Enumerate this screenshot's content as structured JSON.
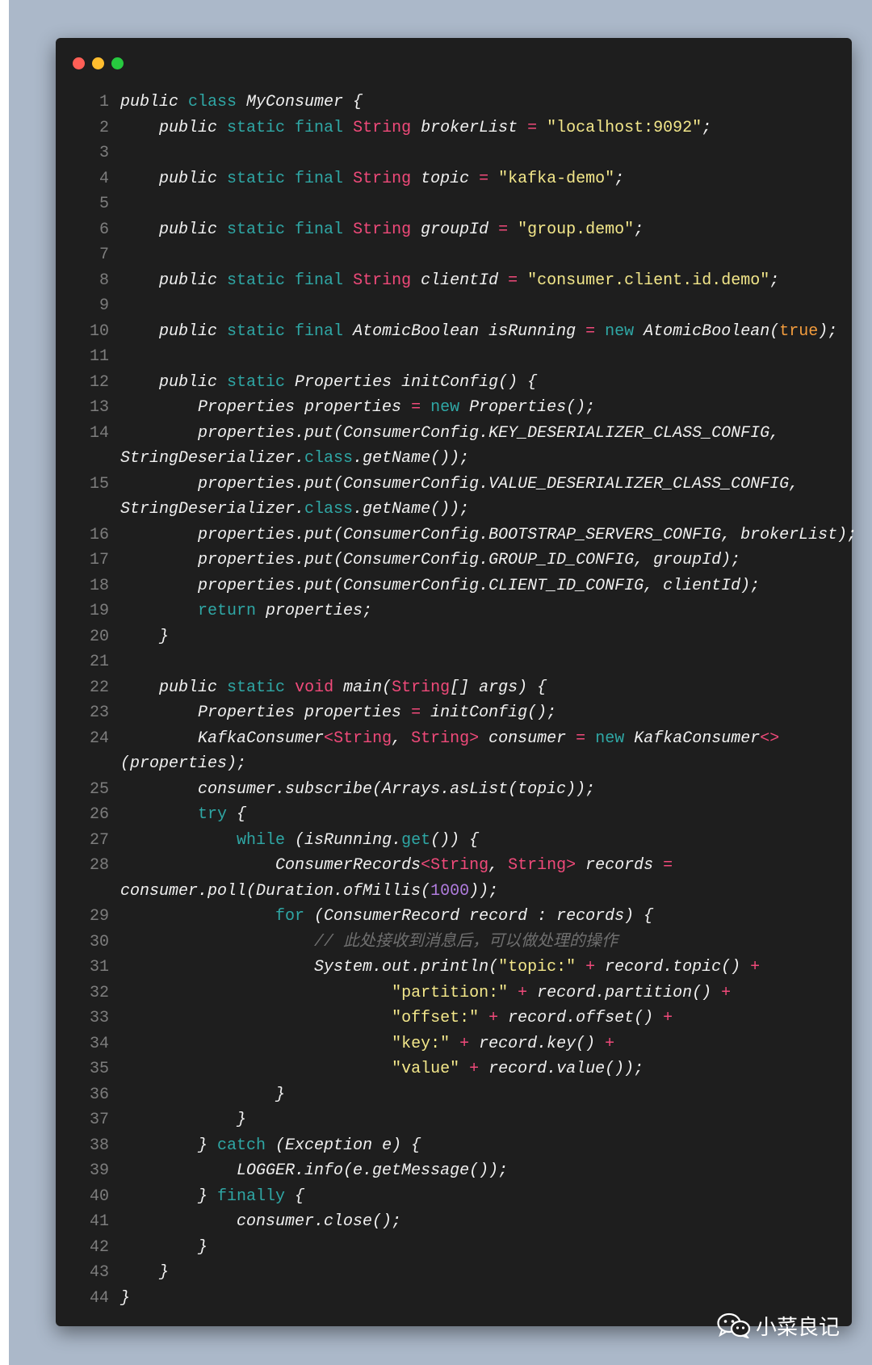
{
  "window": {
    "controls": [
      {
        "name": "close",
        "color": "#ff5f56"
      },
      {
        "name": "minimize",
        "color": "#ffbd2e"
      },
      {
        "name": "zoom",
        "color": "#27c93f"
      }
    ]
  },
  "code_lines": [
    {
      "n": "1",
      "t": [
        [
          "plain",
          "public "
        ],
        [
          "kw",
          "class"
        ],
        [
          "plain",
          " MyConsumer {"
        ]
      ]
    },
    {
      "n": "2",
      "t": [
        [
          "plain",
          "    public "
        ],
        [
          "kw",
          "static final"
        ],
        [
          "plain",
          " "
        ],
        [
          "ty",
          "String"
        ],
        [
          "plain",
          " brokerList "
        ],
        [
          "op",
          "="
        ],
        [
          "plain",
          " "
        ],
        [
          "str",
          "\"localhost:9092\""
        ],
        [
          "plain",
          ";"
        ]
      ]
    },
    {
      "n": "3",
      "t": []
    },
    {
      "n": "4",
      "t": [
        [
          "plain",
          "    public "
        ],
        [
          "kw",
          "static final"
        ],
        [
          "plain",
          " "
        ],
        [
          "ty",
          "String"
        ],
        [
          "plain",
          " topic "
        ],
        [
          "op",
          "="
        ],
        [
          "plain",
          " "
        ],
        [
          "str",
          "\"kafka-demo\""
        ],
        [
          "plain",
          ";"
        ]
      ]
    },
    {
      "n": "5",
      "t": []
    },
    {
      "n": "6",
      "t": [
        [
          "plain",
          "    public "
        ],
        [
          "kw",
          "static final"
        ],
        [
          "plain",
          " "
        ],
        [
          "ty",
          "String"
        ],
        [
          "plain",
          " groupId "
        ],
        [
          "op",
          "="
        ],
        [
          "plain",
          " "
        ],
        [
          "str",
          "\"group.demo\""
        ],
        [
          "plain",
          ";"
        ]
      ]
    },
    {
      "n": "7",
      "t": []
    },
    {
      "n": "8",
      "t": [
        [
          "plain",
          "    public "
        ],
        [
          "kw",
          "static final"
        ],
        [
          "plain",
          " "
        ],
        [
          "ty",
          "String"
        ],
        [
          "plain",
          " clientId "
        ],
        [
          "op",
          "="
        ],
        [
          "plain",
          " "
        ],
        [
          "str",
          "\"consumer.client.id.demo\""
        ],
        [
          "plain",
          ";"
        ]
      ]
    },
    {
      "n": "9",
      "t": []
    },
    {
      "n": "10",
      "t": [
        [
          "plain",
          "    public "
        ],
        [
          "kw",
          "static final"
        ],
        [
          "plain",
          " AtomicBoolean isRunning "
        ],
        [
          "op",
          "="
        ],
        [
          "plain",
          " "
        ],
        [
          "kw",
          "new"
        ],
        [
          "plain",
          " AtomicBoolean("
        ],
        [
          "bool",
          "true"
        ],
        [
          "plain",
          ");"
        ]
      ]
    },
    {
      "n": "11",
      "t": []
    },
    {
      "n": "12",
      "t": [
        [
          "plain",
          "    public "
        ],
        [
          "kw",
          "static"
        ],
        [
          "plain",
          " Properties initConfig() {"
        ]
      ]
    },
    {
      "n": "13",
      "t": [
        [
          "plain",
          "        Properties properties "
        ],
        [
          "op",
          "="
        ],
        [
          "plain",
          " "
        ],
        [
          "kw",
          "new"
        ],
        [
          "plain",
          " Properties();"
        ]
      ]
    },
    {
      "n": "14",
      "t": [
        [
          "plain",
          "        properties.put(ConsumerConfig.KEY_DESERIALIZER_CLASS_CONFIG,"
        ]
      ]
    },
    {
      "n": "",
      "t": [
        [
          "plain",
          "StringDeserializer."
        ],
        [
          "kw",
          "class"
        ],
        [
          "plain",
          ".getName());"
        ]
      ]
    },
    {
      "n": "15",
      "t": [
        [
          "plain",
          "        properties.put(ConsumerConfig.VALUE_DESERIALIZER_CLASS_CONFIG,"
        ]
      ]
    },
    {
      "n": "",
      "t": [
        [
          "plain",
          "StringDeserializer."
        ],
        [
          "kw",
          "class"
        ],
        [
          "plain",
          ".getName());"
        ]
      ]
    },
    {
      "n": "16",
      "t": [
        [
          "plain",
          "        properties.put(ConsumerConfig.BOOTSTRAP_SERVERS_CONFIG, brokerList);"
        ]
      ]
    },
    {
      "n": "17",
      "t": [
        [
          "plain",
          "        properties.put(ConsumerConfig.GROUP_ID_CONFIG, groupId);"
        ]
      ]
    },
    {
      "n": "18",
      "t": [
        [
          "plain",
          "        properties.put(ConsumerConfig.CLIENT_ID_CONFIG, clientId);"
        ]
      ]
    },
    {
      "n": "19",
      "t": [
        [
          "plain",
          "        "
        ],
        [
          "kw",
          "return"
        ],
        [
          "plain",
          " properties;"
        ]
      ]
    },
    {
      "n": "20",
      "t": [
        [
          "plain",
          "    }"
        ]
      ]
    },
    {
      "n": "21",
      "t": []
    },
    {
      "n": "22",
      "t": [
        [
          "plain",
          "    public "
        ],
        [
          "kw",
          "static"
        ],
        [
          "plain",
          " "
        ],
        [
          "ty",
          "void"
        ],
        [
          "plain",
          " main("
        ],
        [
          "ty",
          "String"
        ],
        [
          "plain",
          "[] args) {"
        ]
      ]
    },
    {
      "n": "23",
      "t": [
        [
          "plain",
          "        Properties properties "
        ],
        [
          "op",
          "="
        ],
        [
          "plain",
          " initConfig();"
        ]
      ]
    },
    {
      "n": "24",
      "t": [
        [
          "plain",
          "        KafkaConsumer"
        ],
        [
          "op",
          "<"
        ],
        [
          "ty",
          "String"
        ],
        [
          "plain",
          ", "
        ],
        [
          "ty",
          "String"
        ],
        [
          "op",
          ">"
        ],
        [
          "plain",
          " consumer "
        ],
        [
          "op",
          "="
        ],
        [
          "plain",
          " "
        ],
        [
          "kw",
          "new"
        ],
        [
          "plain",
          " KafkaConsumer"
        ],
        [
          "op",
          "<>"
        ]
      ]
    },
    {
      "n": "",
      "t": [
        [
          "plain",
          "(properties);"
        ]
      ]
    },
    {
      "n": "25",
      "t": [
        [
          "plain",
          "        consumer.subscribe(Arrays.asList(topic));"
        ]
      ]
    },
    {
      "n": "26",
      "t": [
        [
          "plain",
          "        "
        ],
        [
          "kw",
          "try"
        ],
        [
          "plain",
          " {"
        ]
      ]
    },
    {
      "n": "27",
      "t": [
        [
          "plain",
          "            "
        ],
        [
          "kw",
          "while"
        ],
        [
          "plain",
          " (isRunning."
        ],
        [
          "kw",
          "get"
        ],
        [
          "plain",
          "()) {"
        ]
      ]
    },
    {
      "n": "28",
      "t": [
        [
          "plain",
          "                ConsumerRecords"
        ],
        [
          "op",
          "<"
        ],
        [
          "ty",
          "String"
        ],
        [
          "plain",
          ", "
        ],
        [
          "ty",
          "String"
        ],
        [
          "op",
          ">"
        ],
        [
          "plain",
          " records "
        ],
        [
          "op",
          "="
        ]
      ]
    },
    {
      "n": "",
      "t": [
        [
          "plain",
          "consumer.poll(Duration.ofMillis("
        ],
        [
          "num",
          "1000"
        ],
        [
          "plain",
          "));"
        ]
      ]
    },
    {
      "n": "29",
      "t": [
        [
          "plain",
          "                "
        ],
        [
          "kw",
          "for"
        ],
        [
          "plain",
          " (ConsumerRecord record : records) {"
        ]
      ]
    },
    {
      "n": "30",
      "t": [
        [
          "plain",
          "                    "
        ],
        [
          "cm",
          "// 此处接收到消息后，可以做处理的操作"
        ]
      ]
    },
    {
      "n": "31",
      "t": [
        [
          "plain",
          "                    System.out.println("
        ],
        [
          "str",
          "\"topic:\""
        ],
        [
          "plain",
          " "
        ],
        [
          "op",
          "+"
        ],
        [
          "plain",
          " record.topic() "
        ],
        [
          "op",
          "+"
        ]
      ]
    },
    {
      "n": "32",
      "t": [
        [
          "plain",
          "                            "
        ],
        [
          "str",
          "\"partition:\""
        ],
        [
          "plain",
          " "
        ],
        [
          "op",
          "+"
        ],
        [
          "plain",
          " record.partition() "
        ],
        [
          "op",
          "+"
        ]
      ]
    },
    {
      "n": "33",
      "t": [
        [
          "plain",
          "                            "
        ],
        [
          "str",
          "\"offset:\""
        ],
        [
          "plain",
          " "
        ],
        [
          "op",
          "+"
        ],
        [
          "plain",
          " record.offset() "
        ],
        [
          "op",
          "+"
        ]
      ]
    },
    {
      "n": "34",
      "t": [
        [
          "plain",
          "                            "
        ],
        [
          "str",
          "\"key:\""
        ],
        [
          "plain",
          " "
        ],
        [
          "op",
          "+"
        ],
        [
          "plain",
          " record.key() "
        ],
        [
          "op",
          "+"
        ]
      ]
    },
    {
      "n": "35",
      "t": [
        [
          "plain",
          "                            "
        ],
        [
          "str",
          "\"value\""
        ],
        [
          "plain",
          " "
        ],
        [
          "op",
          "+"
        ],
        [
          "plain",
          " record.value());"
        ]
      ]
    },
    {
      "n": "36",
      "t": [
        [
          "plain",
          "                }"
        ]
      ]
    },
    {
      "n": "37",
      "t": [
        [
          "plain",
          "            }"
        ]
      ]
    },
    {
      "n": "38",
      "t": [
        [
          "plain",
          "        } "
        ],
        [
          "kw",
          "catch"
        ],
        [
          "plain",
          " (Exception e) {"
        ]
      ]
    },
    {
      "n": "39",
      "t": [
        [
          "plain",
          "            LOGGER.info(e.getMessage());"
        ]
      ]
    },
    {
      "n": "40",
      "t": [
        [
          "plain",
          "        } "
        ],
        [
          "kw",
          "finally"
        ],
        [
          "plain",
          " {"
        ]
      ]
    },
    {
      "n": "41",
      "t": [
        [
          "plain",
          "            consumer.close();"
        ]
      ]
    },
    {
      "n": "42",
      "t": [
        [
          "plain",
          "        }"
        ]
      ]
    },
    {
      "n": "43",
      "t": [
        [
          "plain",
          "    }"
        ]
      ]
    },
    {
      "n": "44",
      "t": [
        [
          "plain",
          "}"
        ]
      ]
    }
  ],
  "watermark": {
    "icon": "wechat-icon",
    "text": "小菜良记"
  }
}
